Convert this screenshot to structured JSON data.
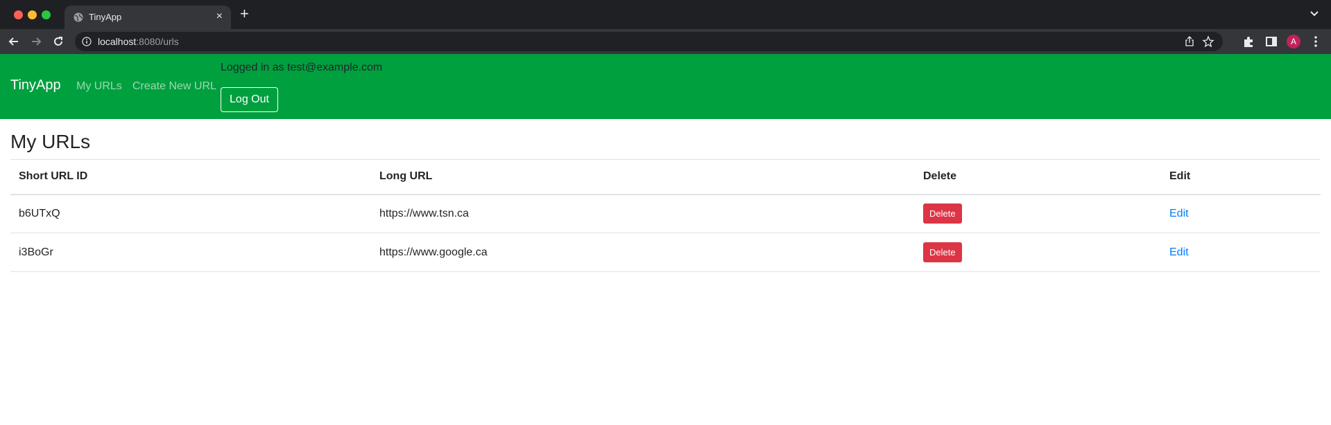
{
  "browser": {
    "tab_title": "TinyApp",
    "tab_close": "×",
    "new_tab": "+",
    "url_host": "localhost",
    "url_rest": ":8080/urls",
    "avatar_letter": "A"
  },
  "navbar": {
    "brand": "TinyApp",
    "links": [
      {
        "label": "My URLs"
      },
      {
        "label": "Create New URL"
      }
    ],
    "login_text": "Logged in as test@example.com",
    "logout_label": "Log Out"
  },
  "main": {
    "title": "My URLs",
    "table": {
      "headers": [
        "Short URL ID",
        "Long URL",
        "Delete",
        "Edit"
      ],
      "rows": [
        {
          "short_id": "b6UTxQ",
          "long_url": "https://www.tsn.ca",
          "delete_label": "Delete",
          "edit_label": "Edit"
        },
        {
          "short_id": "i3BoGr",
          "long_url": "https://www.google.ca",
          "delete_label": "Delete",
          "edit_label": "Edit"
        }
      ]
    }
  },
  "colors": {
    "navbar_bg": "#00a03f",
    "delete_button": "#dc3545",
    "link": "#007bff"
  }
}
